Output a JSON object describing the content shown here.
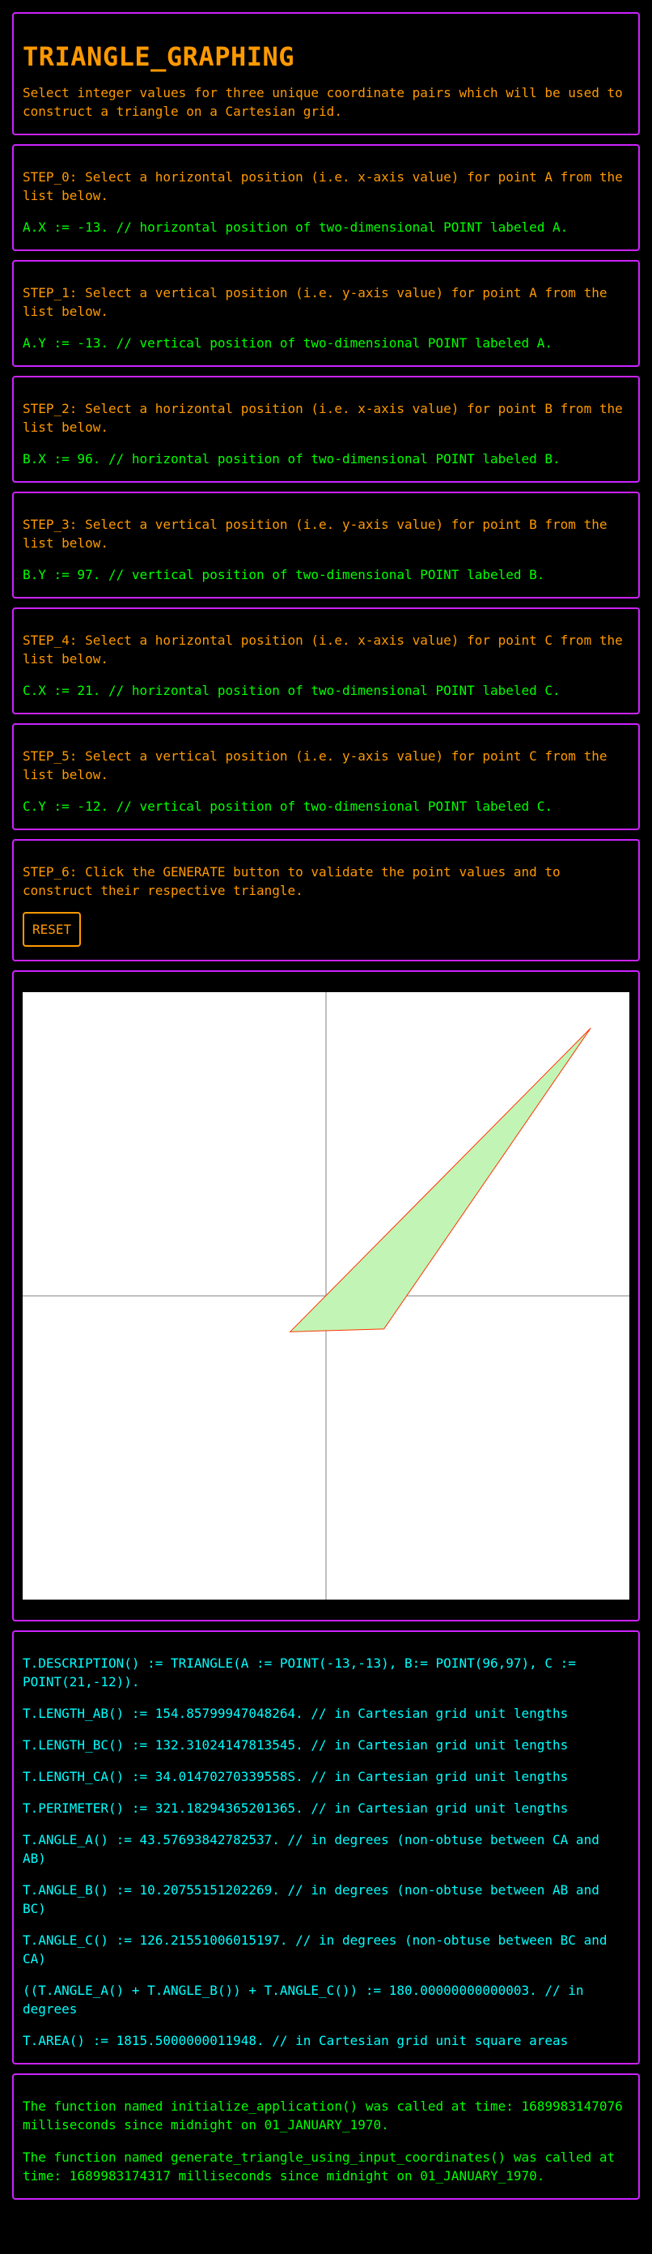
{
  "header": {
    "title": "TRIANGLE_GRAPHING",
    "intro": "Select integer values for three unique coordinate pairs which will be used to construct a triangle on a Cartesian grid."
  },
  "steps": [
    {
      "instruction": "STEP_0: Select a horizontal position (i.e. x-axis value) for point A from the list below.",
      "value_line": "A.X := -13. // horizontal position of two-dimensional POINT labeled A."
    },
    {
      "instruction": "STEP_1: Select a vertical position (i.e. y-axis value) for point A from the list below.",
      "value_line": "A.Y := -13. // vertical position of two-dimensional POINT labeled A."
    },
    {
      "instruction": "STEP_2: Select a horizontal position (i.e. x-axis value) for point B from the list below.",
      "value_line": "B.X := 96. // horizontal position of two-dimensional POINT labeled B."
    },
    {
      "instruction": "STEP_3: Select a vertical position (i.e. y-axis value) for point B from the list below.",
      "value_line": "B.Y := 97. // vertical position of two-dimensional POINT labeled B."
    },
    {
      "instruction": "STEP_4: Select a horizontal position (i.e. x-axis value) for point C from the list below.",
      "value_line": "C.X := 21. // horizontal position of two-dimensional POINT labeled C."
    },
    {
      "instruction": "STEP_5: Select a vertical position (i.e. y-axis value) for point C from the list below.",
      "value_line": "C.Y := -12. // vertical position of two-dimensional POINT labeled C."
    }
  ],
  "step6": {
    "instruction": "STEP_6: Click the GENERATE button to validate the point values and to construct their respective triangle.",
    "reset_label": "RESET"
  },
  "graph": {
    "points": {
      "A": [
        -13,
        -13
      ],
      "B": [
        96,
        97
      ],
      "C": [
        21,
        -12
      ]
    },
    "range": [
      -110,
      110
    ],
    "fill_color": "#c2f5b5",
    "stroke_color": "#ff3300",
    "axis_color": "#808080"
  },
  "results": [
    "T.DESCRIPTION() := TRIANGLE(A := POINT(-13,-13), B:= POINT(96,97), C := POINT(21,-12)).",
    "T.LENGTH_AB() := 154.85799947048264. // in Cartesian grid unit lengths",
    "T.LENGTH_BC() := 132.31024147813545. // in Cartesian grid unit lengths",
    "T.LENGTH_CA() := 34.01470270339558S. // in Cartesian grid unit lengths",
    "T.PERIMETER() := 321.18294365201365. // in Cartesian grid unit lengths",
    "T.ANGLE_A() := 43.57693842782537. // in degrees (non-obtuse between CA and AB)",
    "T.ANGLE_B() := 10.20755151202269. // in degrees (non-obtuse between AB and BC)",
    "T.ANGLE_C() := 126.21551006015197. // in degrees (non-obtuse between BC and CA)",
    "((T.ANGLE_A() + T.ANGLE_B()) + T.ANGLE_C()) := 180.00000000000003. // in degrees",
    "T.AREA() := 1815.5000000011948. // in Cartesian grid unit square areas"
  ],
  "log": [
    "The function named initialize_application() was called at time: 1689983147076 milliseconds since midnight on 01_JANUARY_1970.",
    "The function named generate_triangle_using_input_coordinates() was called at time: 1689983174317 milliseconds since midnight on 01_JANUARY_1970."
  ]
}
